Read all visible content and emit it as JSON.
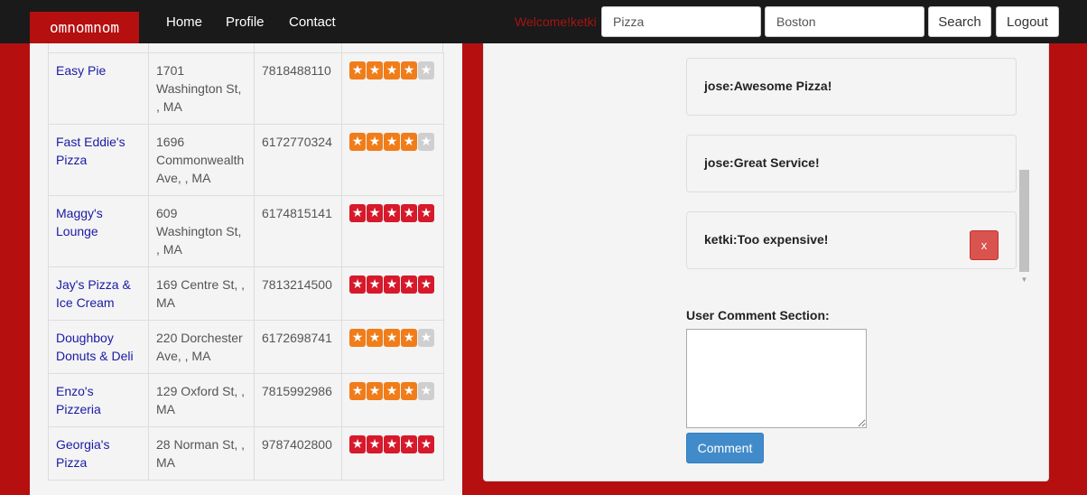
{
  "navbar": {
    "brand": "omnomnom",
    "links": [
      "Home",
      "Profile",
      "Contact"
    ],
    "welcome": "Welcome!ketki",
    "search_term": "Pizza",
    "location": "Boston",
    "search_label": "Search",
    "logout_label": "Logout"
  },
  "restaurants": [
    {
      "name": "Easy Pie",
      "address": "1701 Washington St, , MA",
      "phone": "7818488110",
      "rating": 4,
      "star_color": "orange"
    },
    {
      "name": "Fast Eddie's Pizza",
      "address": "1696 Commonwealth Ave, , MA",
      "phone": "6172770324",
      "rating": 4,
      "star_color": "orange"
    },
    {
      "name": "Maggy's Lounge",
      "address": "609 Washington St, , MA",
      "phone": "6174815141",
      "rating": 5,
      "star_color": "red"
    },
    {
      "name": "Jay's Pizza & Ice Cream",
      "address": "169 Centre St, , MA",
      "phone": "7813214500",
      "rating": 5,
      "star_color": "red"
    },
    {
      "name": "Doughboy Donuts & Deli",
      "address": "220 Dorchester Ave, , MA",
      "phone": "6172698741",
      "rating": 4,
      "star_color": "orange"
    },
    {
      "name": "Enzo's Pizzeria",
      "address": "129 Oxford St, , MA",
      "phone": "7815992986",
      "rating": 4,
      "star_color": "orange"
    },
    {
      "name": "Georgia's Pizza",
      "address": "28 Norman St, , MA",
      "phone": "9787402800",
      "rating": 5,
      "star_color": "red"
    }
  ],
  "comments": [
    {
      "user": "jose",
      "text": "Awesome Pizza!",
      "deletable": false
    },
    {
      "user": "jose",
      "text": "Great Service!",
      "deletable": false
    },
    {
      "user": "ketki",
      "text": "Too expensive!",
      "deletable": true,
      "delete_label": "x"
    }
  ],
  "comment_section": {
    "label": "User Comment Section:",
    "value": "",
    "submit_label": "Comment"
  },
  "colors": {
    "brand_red": "#b50f0f",
    "star_orange": "#f07d1a",
    "star_red": "#d6192b",
    "star_grey": "#cfcfcf",
    "comment_button": "#428bca",
    "delete_button": "#d9534f"
  }
}
